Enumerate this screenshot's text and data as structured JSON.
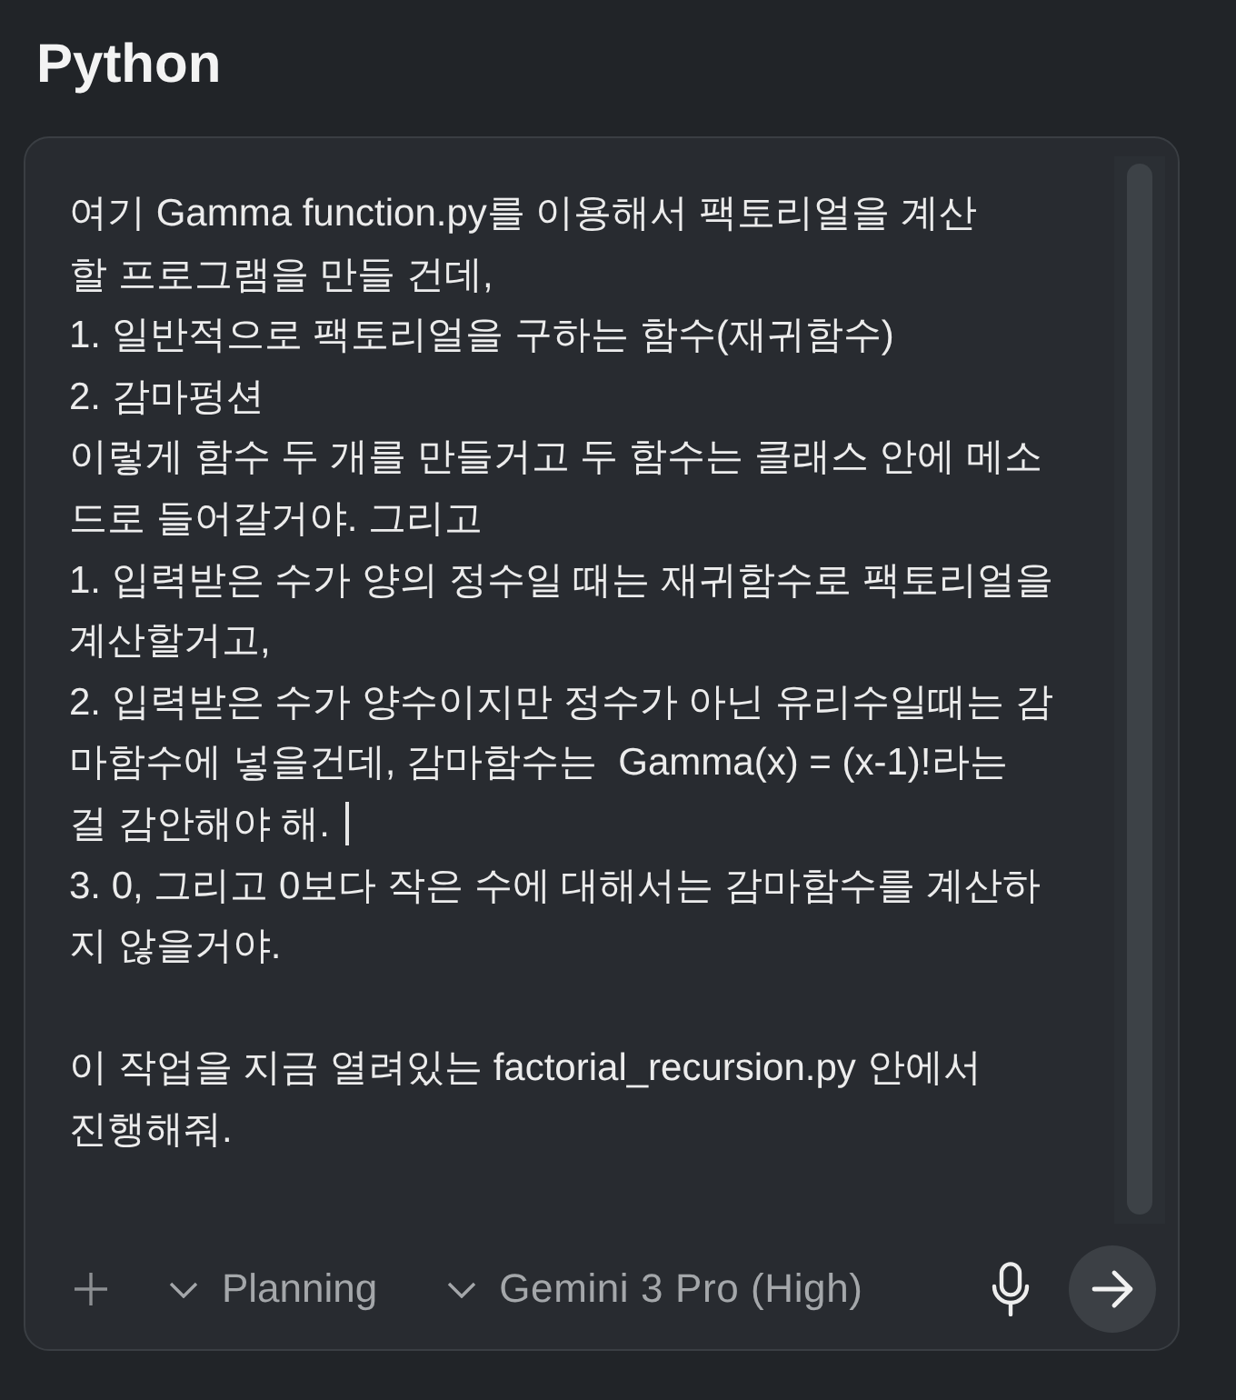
{
  "header": {
    "title": "Python"
  },
  "prompt": {
    "paragraphs": [
      {
        "lines": [
          {
            "text": "여기 Gamma function.py를 이용해서 팩토리얼을 계산",
            "cursor": false
          },
          {
            "text": "할 프로그램을 만들 건데,",
            "cursor": false
          },
          {
            "text": "1. 일반적으로 팩토리얼을 구하는 함수(재귀함수)",
            "cursor": false
          },
          {
            "text": "2. 감마펑션",
            "cursor": false
          },
          {
            "text": "이렇게 함수 두 개를 만들거고 두 함수는 클래스 안에 메소",
            "cursor": false
          },
          {
            "text": "드로 들어갈거야. 그리고",
            "cursor": false
          },
          {
            "text": "1. 입력받은 수가 양의 정수일 때는 재귀함수로 팩토리얼을",
            "cursor": false
          },
          {
            "text": "계산할거고,",
            "cursor": false
          },
          {
            "text": "2. 입력받은 수가 양수이지만 정수가 아닌 유리수일때는 감",
            "cursor": false
          },
          {
            "text": "마함수에 넣을건데, 감마함수는  Gamma(x) = (x-1)!라는",
            "cursor": false
          },
          {
            "text": "걸 감안해야 해.",
            "cursor": true
          },
          {
            "text": "3. 0, 그리고 0보다 작은 수에 대해서는 감마함수를 계산하",
            "cursor": false
          },
          {
            "text": "지 않을거야.",
            "cursor": false
          }
        ]
      },
      {
        "lines": [
          {
            "text": "이 작업을 지금 열려있는 factorial_recursion.py 안에서",
            "cursor": false
          },
          {
            "text": "진행해줘.",
            "cursor": false
          }
        ]
      }
    ]
  },
  "toolbar": {
    "mode_dropdown": {
      "label": "Planning"
    },
    "model_dropdown": {
      "label": "Gemini 3 Pro (High)"
    }
  }
}
